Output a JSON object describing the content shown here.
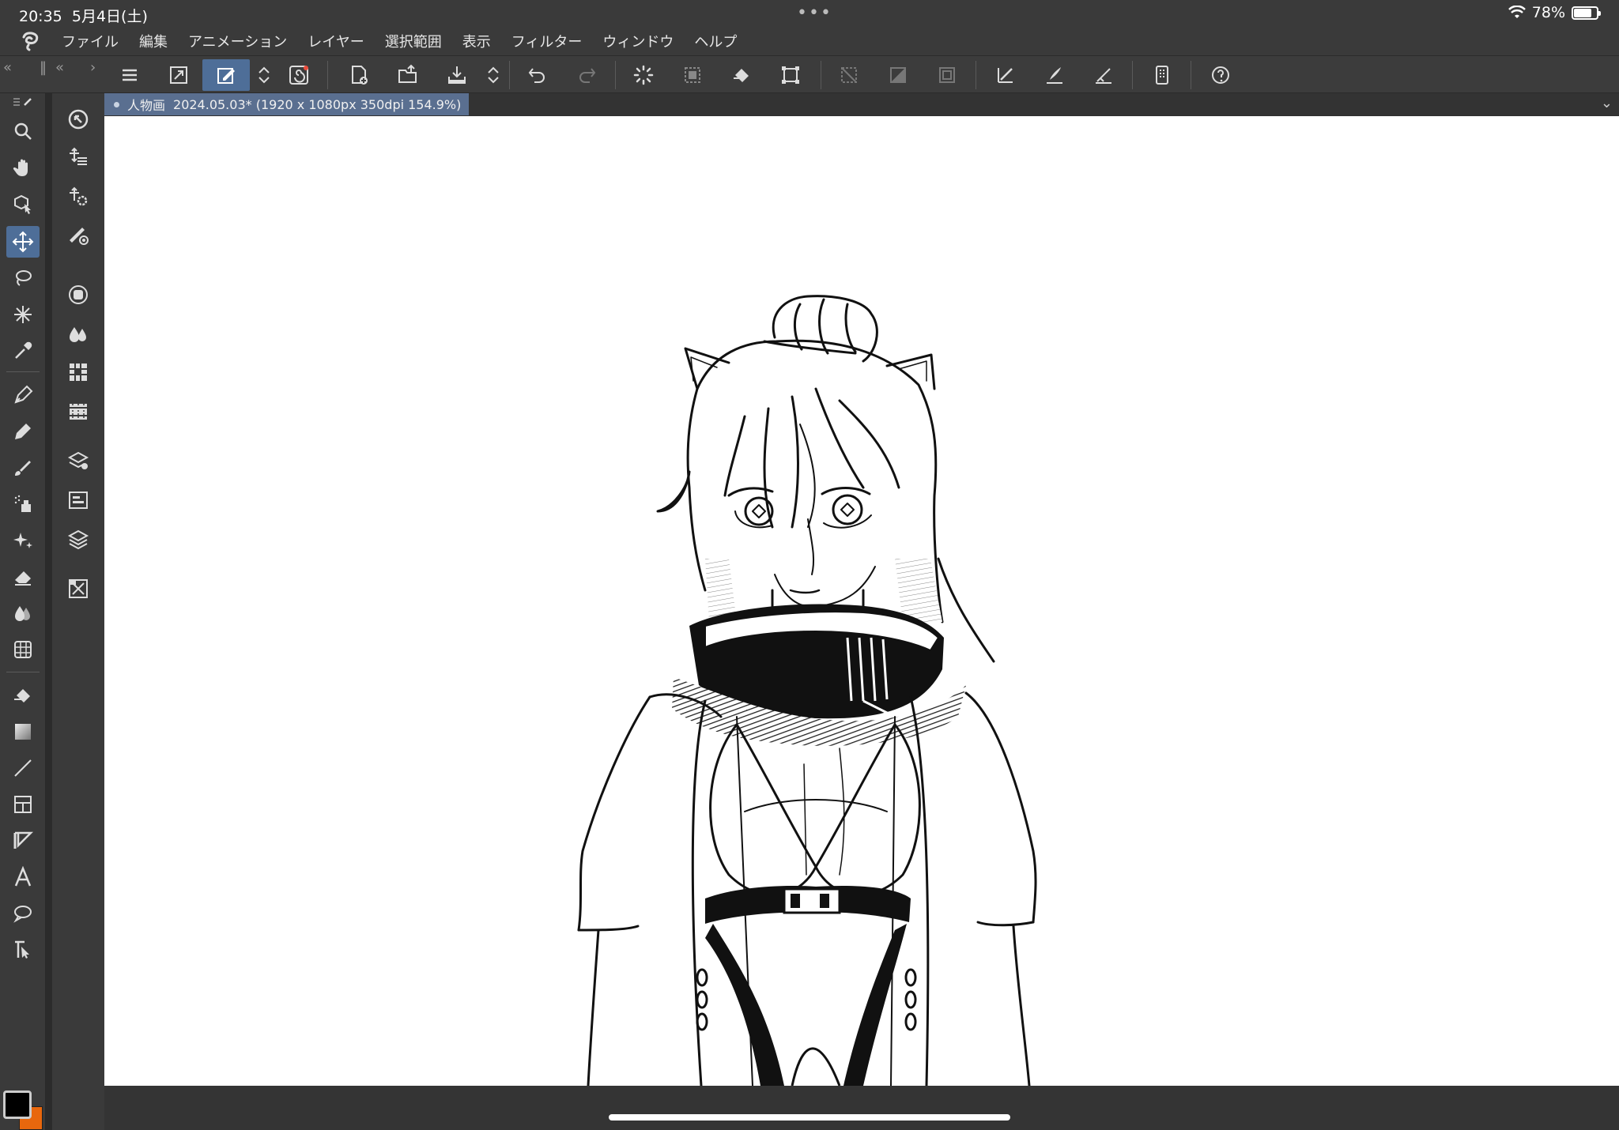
{
  "status_bar": {
    "time": "20:35",
    "date": "5月4日(土)",
    "dots": "•••",
    "battery_percent": "78%",
    "battery_level": 0.78
  },
  "menu": [
    "ファイル",
    "編集",
    "アニメーション",
    "レイヤー",
    "選択範囲",
    "表示",
    "フィルター",
    "ウィンドウ",
    "ヘルプ"
  ],
  "document": {
    "name": "人物画",
    "info": "2024.05.03* (1920 x 1080px 350dpi 154.9%)"
  },
  "colors": {
    "main": "#000000",
    "sub": "#e8670d",
    "accent": "#4e6e98"
  },
  "toolbar_icons": [
    "menu-icon",
    "fit-view-icon",
    "edit-modify-icon",
    "updown-icon",
    "spiral-icon",
    "new-icon",
    "open-icon",
    "save-icon",
    "updown-icon",
    "undo-icon",
    "redo-icon",
    "loading-icon",
    "selection-icon",
    "fill-icon",
    "transform-icon",
    "clear-outside-icon",
    "invert-icon",
    "snap-icon",
    "ruler-snap-icon",
    "brush-snap-icon",
    "special-ruler-icon",
    "device-icon",
    "help-icon"
  ],
  "tools": [
    "zoom",
    "hand",
    "object",
    "move",
    "lasso",
    "auto-select",
    "eyedropper",
    "pen",
    "pencil",
    "brush",
    "airbrush",
    "decoration",
    "eraser",
    "blend",
    "mesh",
    "fill",
    "gradient",
    "line",
    "frame",
    "ruler",
    "text",
    "balloon",
    "line-correction"
  ]
}
